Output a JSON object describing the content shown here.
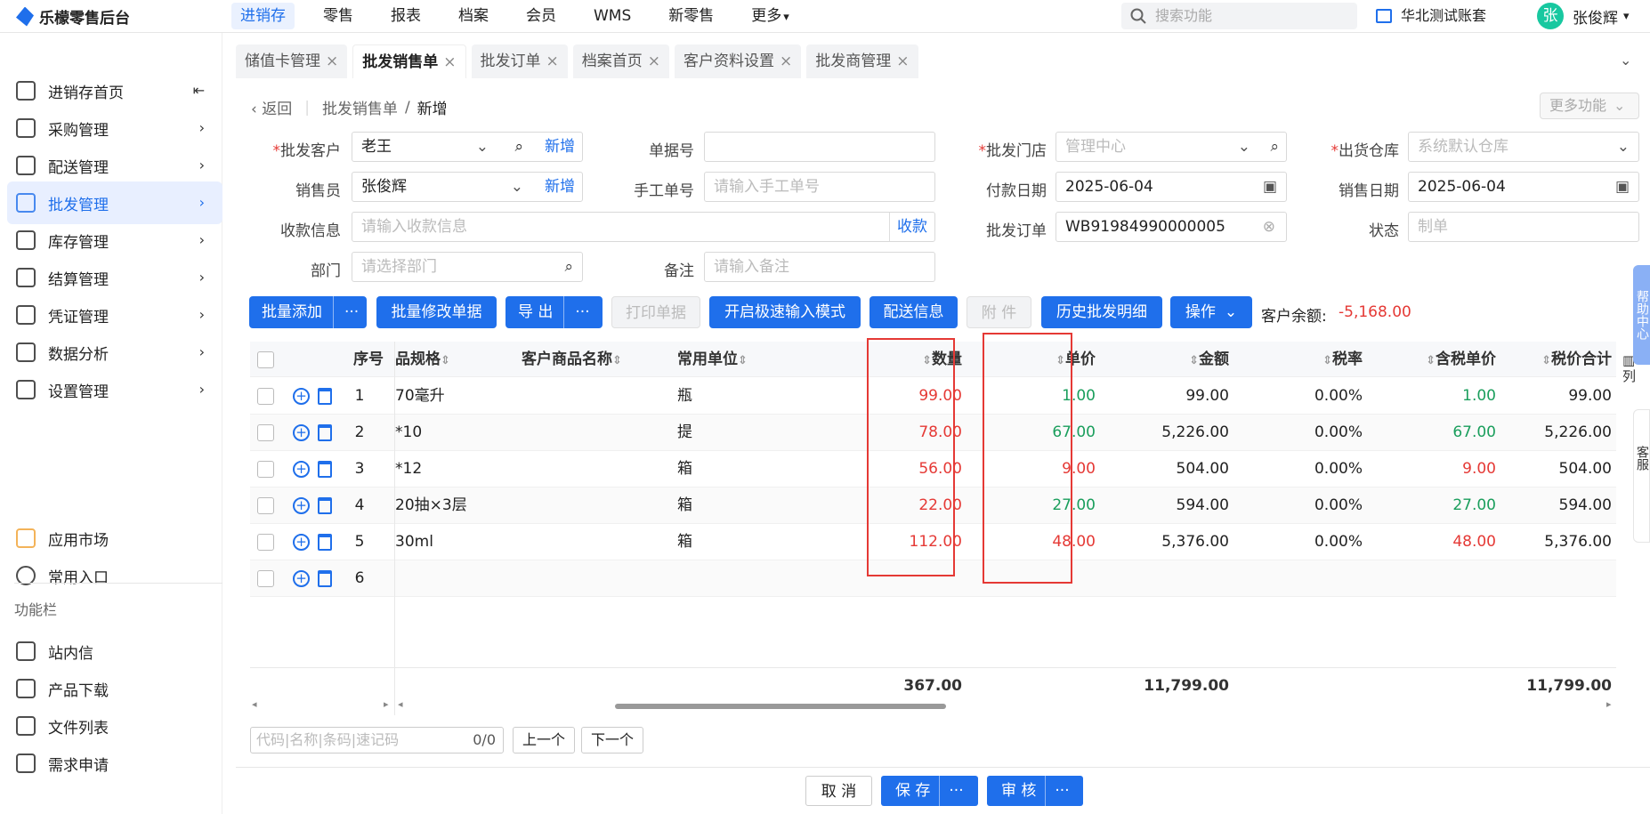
{
  "app": {
    "name": "乐檬零售后台"
  },
  "topnav": [
    "进销存",
    "零售",
    "报表",
    "档案",
    "会员",
    "WMS",
    "新零售",
    "更多"
  ],
  "topnav_more_caret": "▾",
  "search": {
    "placeholder": "搜索功能"
  },
  "account": "华北测试账套",
  "user": {
    "avatar": "张",
    "name": "张俊辉",
    "caret": "▾"
  },
  "sidebar": {
    "items": [
      {
        "label": "进销存首页",
        "icon": "home-icon",
        "suffix": "⇤"
      },
      {
        "label": "采购管理",
        "icon": "cart-icon",
        "suffix": "›"
      },
      {
        "label": "配送管理",
        "icon": "delivery-icon",
        "suffix": "›"
      },
      {
        "label": "批发管理",
        "icon": "wholesale-icon",
        "suffix": "›",
        "active": true
      },
      {
        "label": "库存管理",
        "icon": "inventory-icon",
        "suffix": "›"
      },
      {
        "label": "结算管理",
        "icon": "settlement-icon",
        "suffix": "›"
      },
      {
        "label": "凭证管理",
        "icon": "voucher-icon",
        "suffix": "›"
      },
      {
        "label": "数据分析",
        "icon": "chart-icon",
        "suffix": "›"
      },
      {
        "label": "设置管理",
        "icon": "settings-icon",
        "suffix": "›"
      }
    ],
    "extra": [
      {
        "label": "应用市场",
        "icon": "app-market-icon"
      },
      {
        "label": "常用入口",
        "icon": "heart-icon"
      }
    ],
    "section_caption": "功能栏",
    "tools": [
      {
        "label": "站内信",
        "icon": "mail-icon"
      },
      {
        "label": "产品下载",
        "icon": "download-icon"
      },
      {
        "label": "文件列表",
        "icon": "file-list-icon"
      },
      {
        "label": "需求申请",
        "icon": "request-icon"
      }
    ]
  },
  "tabs": [
    {
      "label": "储值卡管理"
    },
    {
      "label": "批发销售单",
      "active": true
    },
    {
      "label": "批发订单"
    },
    {
      "label": "档案首页"
    },
    {
      "label": "客户资料设置"
    },
    {
      "label": "批发商管理"
    }
  ],
  "tab_close": "×",
  "tabs_more_arrow": "⌄",
  "breadcrumb": {
    "back": "返回",
    "parent": "批发销售单",
    "sep": "/",
    "current": "新增"
  },
  "more_functions": "更多功能",
  "more_functions_caret": "⌄",
  "form": {
    "customer": {
      "label": "批发客户",
      "value": "老王",
      "action": "新增"
    },
    "order_no": {
      "label": "单据号",
      "value": ""
    },
    "store": {
      "label": "批发门店",
      "value": "管理中心"
    },
    "warehouse": {
      "label": "出货仓库",
      "value": "系统默认仓库"
    },
    "salesman": {
      "label": "销售员",
      "value": "张俊辉",
      "action": "新增"
    },
    "manual_no": {
      "label": "手工单号",
      "placeholder": "请输入手工单号"
    },
    "pay_date": {
      "label": "付款日期",
      "value": "2025-06-04"
    },
    "sale_date": {
      "label": "销售日期",
      "value": "2025-06-04"
    },
    "receipt_info": {
      "label": "收款信息",
      "placeholder": "请输入收款信息",
      "action": "收款"
    },
    "wholesale_order": {
      "label": "批发订单",
      "value": "WB91984990000005"
    },
    "status": {
      "label": "状态",
      "value": "制单"
    },
    "department": {
      "label": "部门",
      "placeholder": "请选择部门"
    },
    "remark": {
      "label": "备注",
      "placeholder": "请输入备注"
    },
    "required_mark": "*",
    "dropdown_caret": "⌄",
    "calendar_glyph": "▣",
    "clear_glyph": "⊗"
  },
  "toolbar": {
    "batch_add": "批量添加",
    "batch_edit": "批量修改单据",
    "export": "导 出",
    "print": "打印单据",
    "fast_input": "开启极速输入模式",
    "delivery_info": "配送信息",
    "attachment": "附 件",
    "history": "历史批发明细",
    "operation": "操作",
    "more_glyph": "···",
    "caret": "⌄",
    "balance_label": "客户余额:",
    "balance_value": "-5,168.00"
  },
  "table": {
    "headers": {
      "seq": "序号",
      "spec": "商品规格",
      "cust_name": "客户商品名称",
      "unit": "常用单位",
      "qty": "数量",
      "price": "单价",
      "amount": "金额",
      "tax_rate": "税率",
      "tax_price": "含税单价",
      "tax_total": "税价合计"
    },
    "sort_glyph": "⇕",
    "rows": [
      {
        "seq": "1",
        "spec": "70毫升",
        "unit": "瓶",
        "qty": "99.00",
        "price": "1.00",
        "amount": "99.00",
        "tax_rate": "0.00%",
        "tax_price": "1.00",
        "tax_total": "99.00",
        "price_color": "green"
      },
      {
        "seq": "2",
        "spec": "*10",
        "unit": "提",
        "qty": "78.00",
        "price": "67.00",
        "amount": "5,226.00",
        "tax_rate": "0.00%",
        "tax_price": "67.00",
        "tax_total": "5,226.00",
        "price_color": "green"
      },
      {
        "seq": "3",
        "spec": "*12",
        "unit": "箱",
        "qty": "56.00",
        "price": "9.00",
        "amount": "504.00",
        "tax_rate": "0.00%",
        "tax_price": "9.00",
        "tax_total": "504.00",
        "price_color": "red"
      },
      {
        "seq": "4",
        "spec": "20抽×3层",
        "unit": "箱",
        "qty": "22.00",
        "price": "27.00",
        "amount": "594.00",
        "tax_rate": "0.00%",
        "tax_price": "27.00",
        "tax_total": "594.00",
        "price_color": "green"
      },
      {
        "seq": "5",
        "spec": "30ml",
        "unit": "箱",
        "qty": "112.00",
        "price": "48.00",
        "amount": "5,376.00",
        "tax_rate": "0.00%",
        "tax_price": "48.00",
        "tax_total": "5,376.00",
        "price_color": "red"
      },
      {
        "seq": "6",
        "spec": "",
        "unit": "",
        "qty": "",
        "price": "",
        "amount": "",
        "tax_rate": "",
        "tax_price": "",
        "tax_total": "",
        "price_color": "green"
      }
    ],
    "totals": {
      "qty": "367.00",
      "amount": "11,799.00",
      "tax_total": "11,799.00"
    },
    "add_glyph": "+",
    "scroll_left": "◂",
    "scroll_right": "▸"
  },
  "finder": {
    "placeholder": "代码|名称|条码|速记码",
    "count": "0/0",
    "prev": "上一个",
    "next": "下一个"
  },
  "footer": {
    "cancel": "取 消",
    "save": "保 存",
    "audit": "审 核",
    "more_glyph": "···"
  },
  "right_panel": {
    "help": "帮助中心",
    "column_setting": "列",
    "service": "客服"
  },
  "colors": {
    "primary": "#1f6feb",
    "danger": "#e53935",
    "success": "#1a9e5c"
  }
}
